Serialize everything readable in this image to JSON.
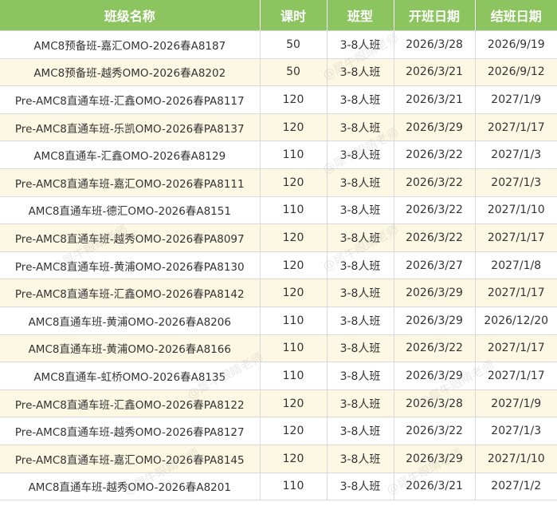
{
  "table": {
    "headers": [
      "班级名称",
      "课时",
      "班型",
      "开班日期",
      "结班日期"
    ],
    "rows": [
      [
        "AMC8预备班-嘉汇OMO-2026春A8187",
        "50",
        "3-8人班",
        "2026/3/28",
        "2026/9/19"
      ],
      [
        "AMC8预备班-越秀OMO-2026春A8202",
        "50",
        "3-8人班",
        "2026/3/21",
        "2026/9/12"
      ],
      [
        "Pre-AMC8直通车班-汇鑫OMO-2026春PA8117",
        "120",
        "3-8人班",
        "2026/3/21",
        "2027/1/9"
      ],
      [
        "Pre-AMC8直通车班-乐凯OMO-2026春PA8137",
        "120",
        "3-8人班",
        "2026/3/29",
        "2027/1/17"
      ],
      [
        "AMC8直通车-汇鑫OMO-2026春A8129",
        "110",
        "3-8人班",
        "2026/3/22",
        "2027/1/3"
      ],
      [
        "Pre-AMC8直通车班-嘉汇OMO-2026春PA8111",
        "120",
        "3-8人班",
        "2026/3/22",
        "2027/1/3"
      ],
      [
        "AMC8直通车班-德汇OMO-2026春A8151",
        "110",
        "3-8人班",
        "2026/3/22",
        "2027/1/10"
      ],
      [
        "Pre-AMC8直通车班-越秀OMO-2026春PA8097",
        "120",
        "3-8人班",
        "2026/3/22",
        "2027/1/17"
      ],
      [
        "Pre-AMC8直通车班-黄浦OMO-2026春PA8130",
        "120",
        "3-8人班",
        "2026/3/27",
        "2027/1/8"
      ],
      [
        "Pre-AMC8直通车班-汇鑫OMO-2026春PA8142",
        "120",
        "3-8人班",
        "2026/3/29",
        "2027/1/17"
      ],
      [
        "AMC8直通车班-黄浦OMO-2026春A8206",
        "110",
        "3-8人班",
        "2026/3/29",
        "2026/12/20"
      ],
      [
        "AMC8直通车班-黄浦OMO-2026春A8166",
        "110",
        "3-8人班",
        "2026/3/22",
        "2027/1/17"
      ],
      [
        "AMC8直通车-虹桥OMO-2026春A8135",
        "110",
        "3-8人班",
        "2026/3/29",
        "2027/1/17"
      ],
      [
        "Pre-AMC8直通车班-汇鑫OMO-2026春PA8122",
        "120",
        "3-8人班",
        "2026/3/28",
        "2027/1/9"
      ],
      [
        "Pre-AMC8直通车班-越秀OMO-2026春PA8127",
        "120",
        "3-8人班",
        "2026/3/22",
        "2027/1/3"
      ],
      [
        "Pre-AMC8直通车班-嘉汇OMO-2026春PA8145",
        "120",
        "3-8人班",
        "2026/3/29",
        "2027/1/10"
      ],
      [
        "AMC8直通车班-越秀OMO-2026春A8201",
        "110",
        "3-8人班",
        "2026/3/21",
        "2027/1/2"
      ]
    ]
  },
  "watermark": {
    "text": "@犀牛眼睛老师"
  },
  "colors": {
    "header_bg": "#8cc460",
    "header_text": "#ffffff",
    "row_alt_bg": "#fcf8e3",
    "row_bg": "#ffffff",
    "grid_line": "#d9d9d9"
  }
}
